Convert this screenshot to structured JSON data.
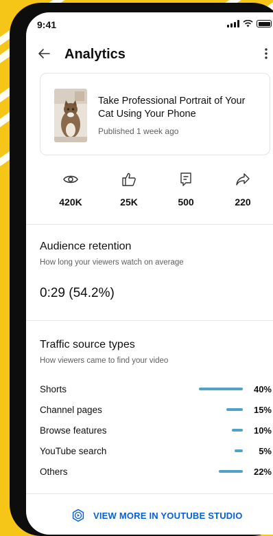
{
  "status": {
    "time": "9:41"
  },
  "header": {
    "title": "Analytics"
  },
  "video": {
    "title": "Take Professional Portrait of Your Cat Using Your Phone",
    "published": "Published 1 week ago"
  },
  "stats": [
    {
      "icon": "eye-icon",
      "value": "420K"
    },
    {
      "icon": "thumbs-up-icon",
      "value": "25K"
    },
    {
      "icon": "comment-icon",
      "value": "500"
    },
    {
      "icon": "share-icon",
      "value": "220"
    }
  ],
  "retention": {
    "title": "Audience retention",
    "subtitle": "How long your viewers watch on average",
    "value": "0:29 (54.2%)"
  },
  "traffic": {
    "title": "Traffic source types",
    "subtitle": "How viewers came to find your video",
    "rows": [
      {
        "label": "Shorts",
        "percent": "40%",
        "value": 40
      },
      {
        "label": "Channel pages",
        "percent": "15%",
        "value": 15
      },
      {
        "label": "Browse features",
        "percent": "10%",
        "value": 10
      },
      {
        "label": "YouTube search",
        "percent": "5%",
        "value": 5
      },
      {
        "label": "Others",
        "percent": "22%",
        "value": 22
      }
    ]
  },
  "footer": {
    "cta": "VIEW MORE IN YOUTUBE STUDIO"
  },
  "colors": {
    "accent": "#065fd4",
    "bar": "#4fa3c8",
    "background": "#f5c518"
  }
}
